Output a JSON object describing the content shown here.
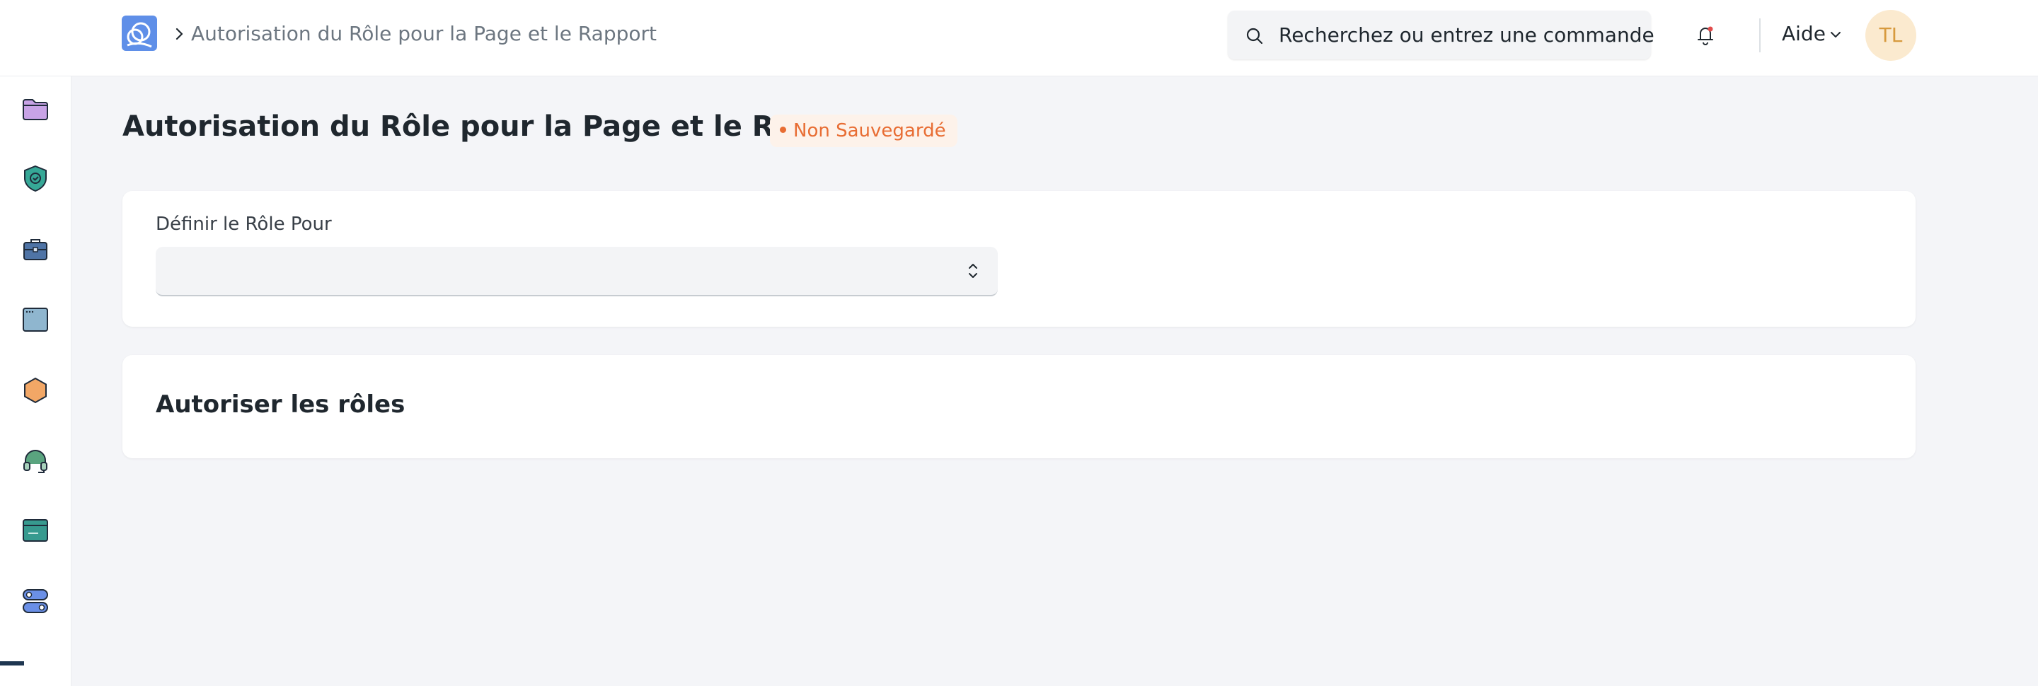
{
  "navbar": {
    "breadcrumb": "Autorisation du Rôle pour la Page et le Rapport",
    "search_placeholder": "Recherchez ou entrez une commande",
    "help_label": "Aide",
    "avatar_initials": "TL"
  },
  "sidebar": {
    "items": [
      {
        "icon": "folder-icon",
        "color": "#b48ad6"
      },
      {
        "icon": "shield-check-icon",
        "color": "#2f9e8f"
      },
      {
        "icon": "briefcase-icon",
        "color": "#4a6fa0"
      },
      {
        "icon": "window-icon",
        "color": "#7fa8c4"
      },
      {
        "icon": "hexagon-icon",
        "color": "#f0a35e"
      },
      {
        "icon": "headset-icon",
        "color": "#4f9a78"
      },
      {
        "icon": "browser-icon",
        "color": "#2f8f86"
      },
      {
        "icon": "toggle-icon",
        "color": "#5f85e0"
      }
    ]
  },
  "page": {
    "title": "Autorisation du Rôle pour la Page et le Rapport",
    "status": "Non Sauvegardé"
  },
  "form": {
    "set_role_for_label": "Définir le Rôle Pour",
    "set_role_for_value": "",
    "allow_roles_title": "Autoriser les rôles"
  },
  "colors": {
    "accent": "#5f8fe8",
    "status_unsaved": "#e86d33",
    "avatar_bg": "#fbeacf"
  }
}
